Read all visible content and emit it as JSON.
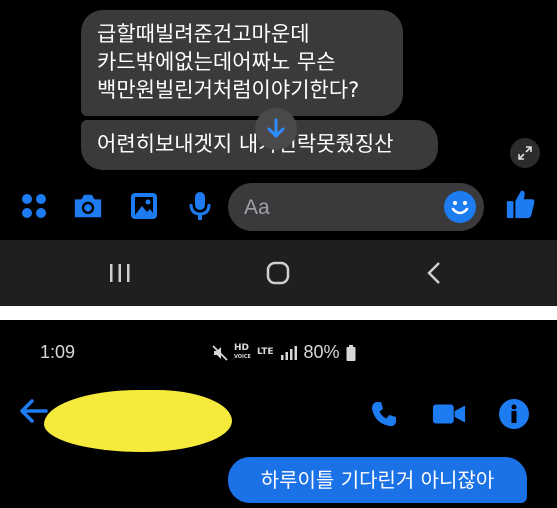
{
  "top_screen": {
    "messages": [
      {
        "lines": [
          "급할때빌려준건고마운데",
          "카드밖에없는데어짜노 무슨",
          "백만원빌린거처럼이야기한다?"
        ]
      },
      {
        "text": "어련히보내겟지 내가연락못줬징산"
      }
    ],
    "composer": {
      "placeholder": "Aa",
      "icons": [
        "apps-icon",
        "camera-icon",
        "image-icon",
        "mic-icon",
        "emoji-icon",
        "thumbs-up-icon"
      ]
    },
    "nav": [
      "recent-apps",
      "home",
      "back"
    ]
  },
  "bottom_screen": {
    "status": {
      "time": "1:09",
      "hd": "HD",
      "hd_sub": "VOICE",
      "lte": "LTE",
      "battery": "80%"
    },
    "header": {
      "contact_name": "",
      "icons": [
        "back-arrow-icon",
        "phone-icon",
        "video-icon",
        "info-icon"
      ]
    },
    "outgoing_message": "하루이틀 기다린거 아니잖아"
  },
  "colors": {
    "accent": "#1d7cf2",
    "bubble_in": "#3a3a3c",
    "bubble_out": "#1b71e6",
    "redaction": "#f6ea3d"
  }
}
